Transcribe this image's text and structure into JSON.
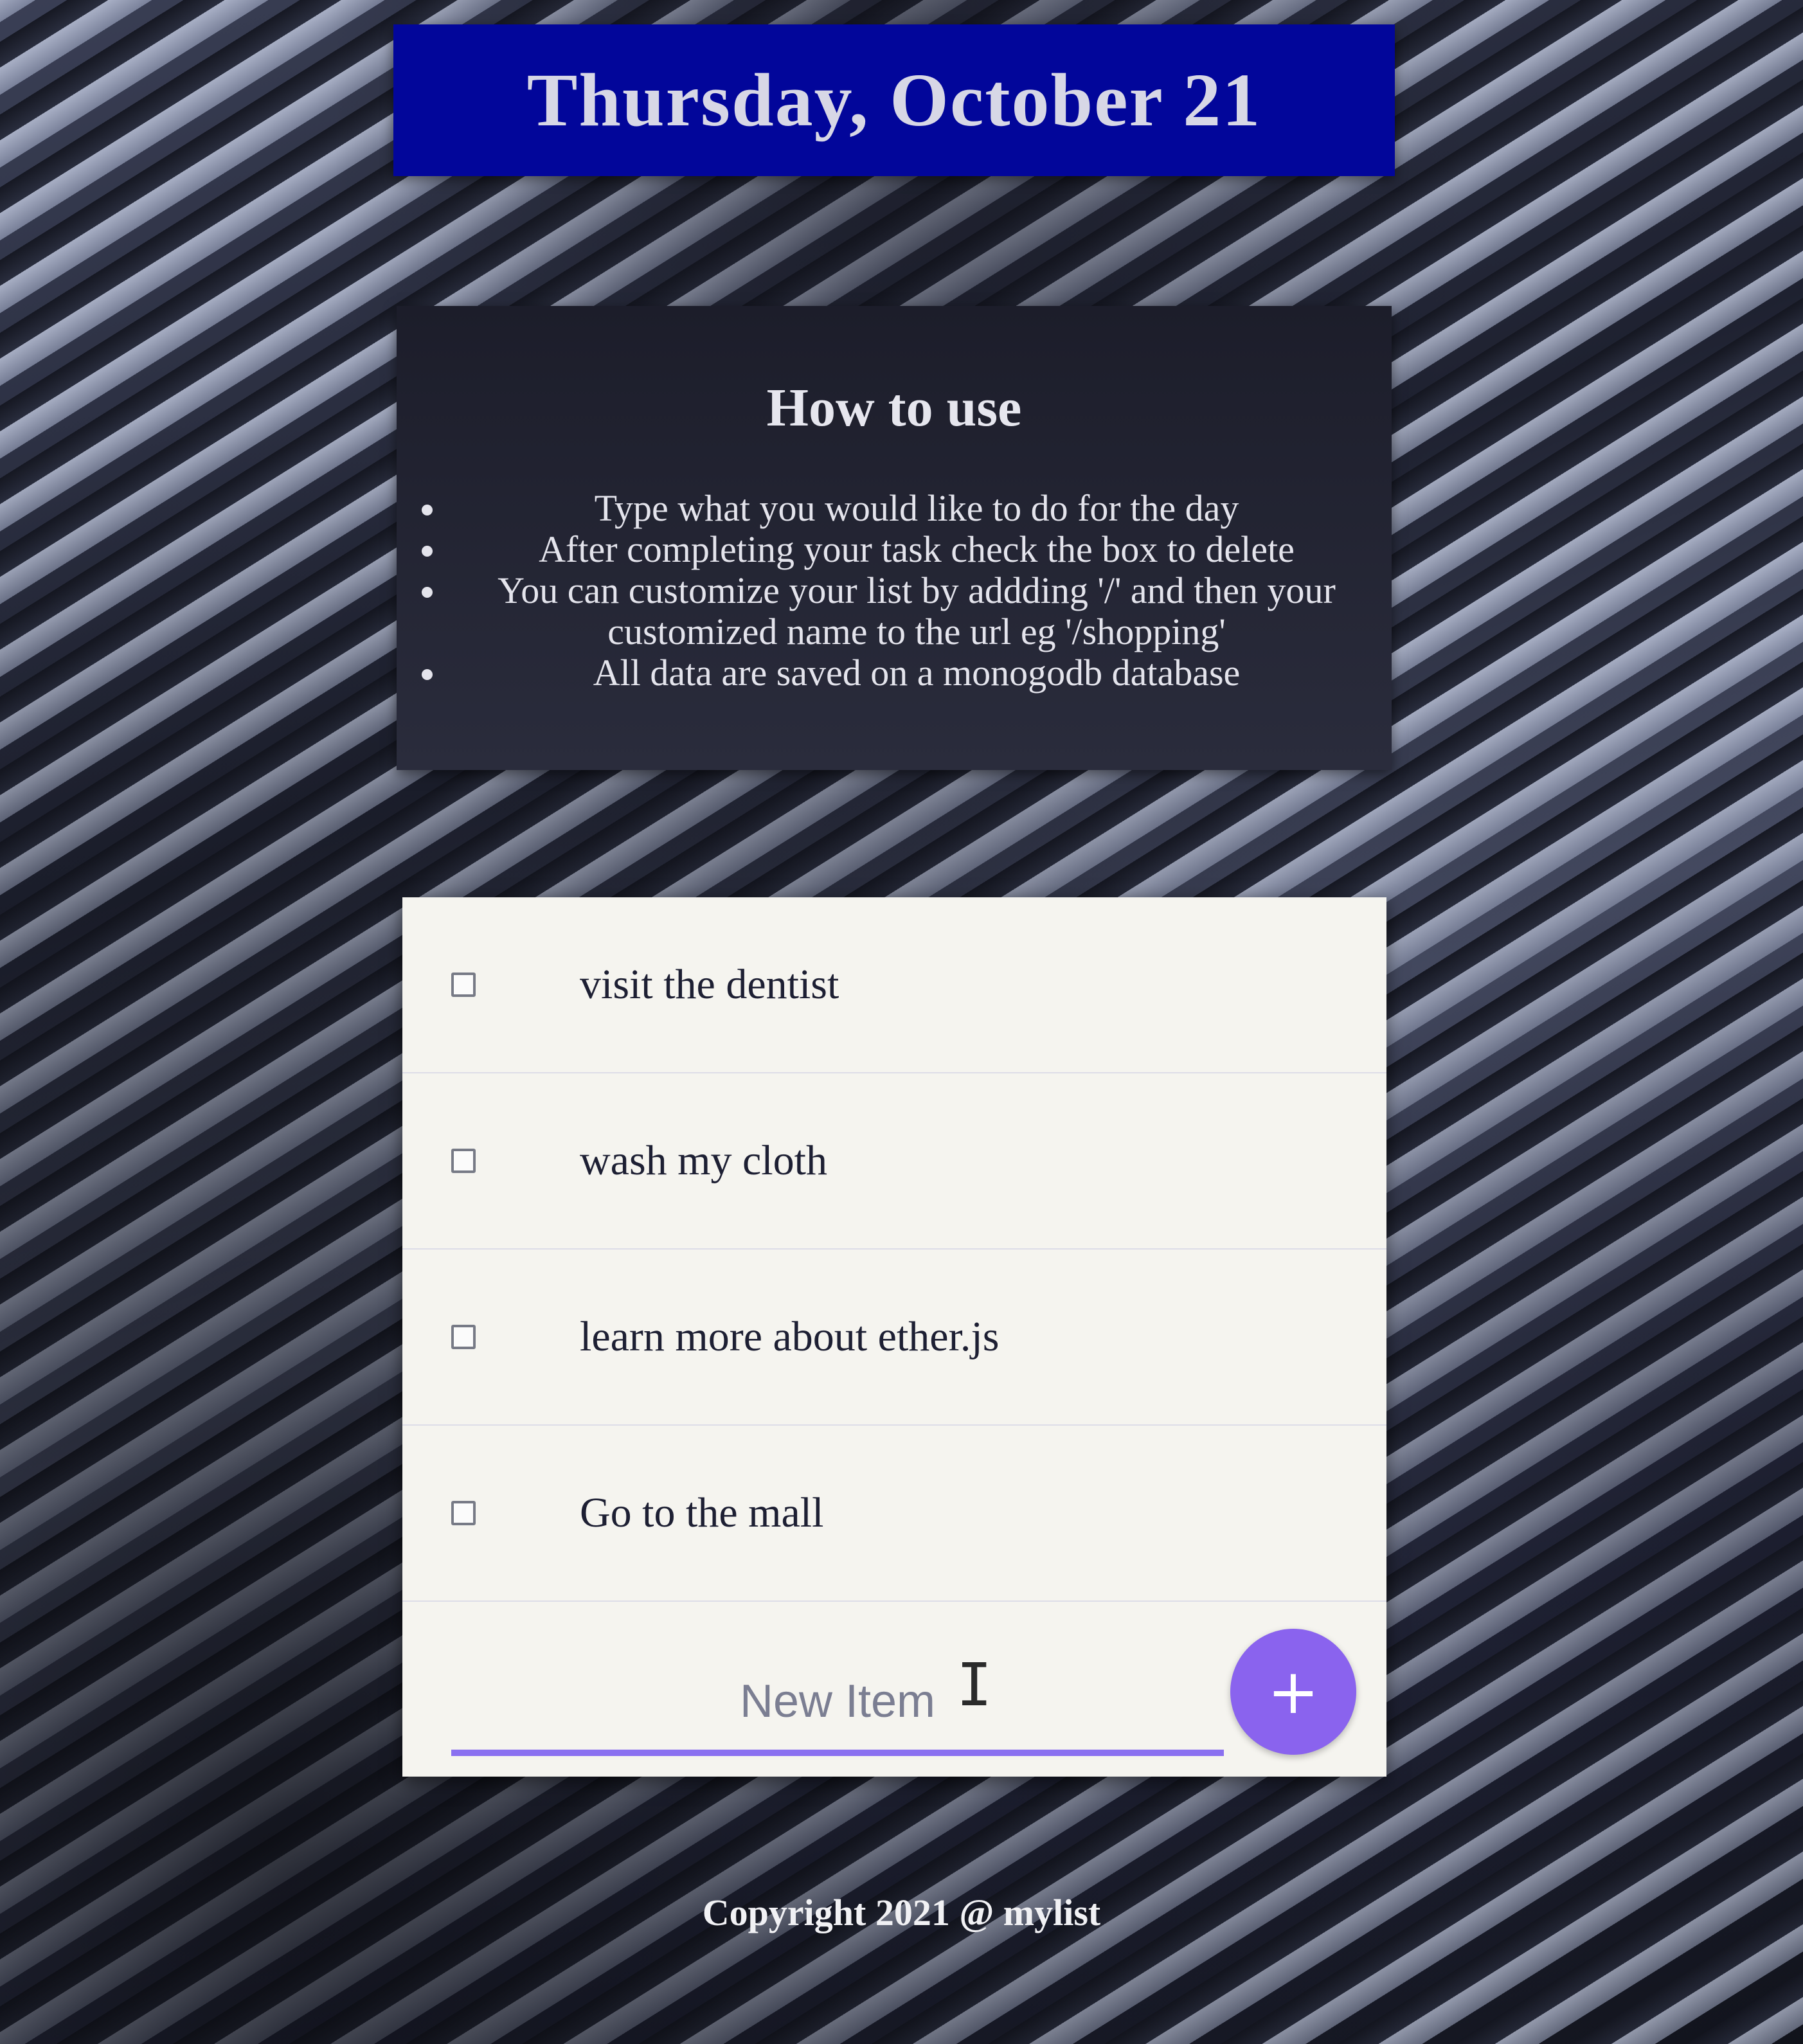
{
  "heading": {
    "date": "Thursday, October 21"
  },
  "howto": {
    "title": "How to use",
    "items": [
      "Type what you would like to do for the day",
      "After completing your task check the box to delete",
      "You can customize your list by addding '/' and then your customized name to the url eg '/shopping'",
      "All data are saved on a monogodb database"
    ]
  },
  "todo": {
    "items": [
      {
        "label": "visit the dentist",
        "checked": false
      },
      {
        "label": "wash my cloth",
        "checked": false
      },
      {
        "label": "learn more about ether.js",
        "checked": false
      },
      {
        "label": "Go to the mall",
        "checked": false
      }
    ],
    "new_item_placeholder": "New Item",
    "add_button_label": "+"
  },
  "footer": {
    "copyright": "Copyright 2021 @ mylist"
  },
  "colors": {
    "heading_bg": "#02069a",
    "accent": "#8a63ee",
    "card_bg": "#f5f4ef"
  }
}
